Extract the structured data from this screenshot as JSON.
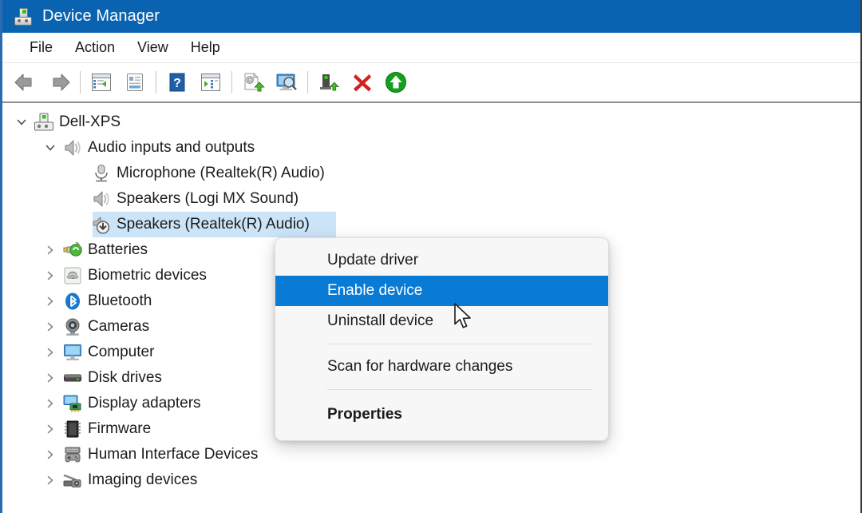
{
  "window": {
    "title": "Device Manager",
    "icon": "device-manager-icon"
  },
  "menubar": {
    "items": [
      {
        "label": "File"
      },
      {
        "label": "Action"
      },
      {
        "label": "View"
      },
      {
        "label": "Help"
      }
    ]
  },
  "toolbar": {
    "buttons": [
      {
        "name": "back-icon",
        "tooltip": "Back"
      },
      {
        "name": "forward-icon",
        "tooltip": "Forward"
      },
      {
        "name": "show-hide-console-tree-icon",
        "tooltip": "Show/Hide Console Tree"
      },
      {
        "name": "properties-icon",
        "tooltip": "Properties"
      },
      {
        "name": "help-icon",
        "tooltip": "Help"
      },
      {
        "name": "show-hide-action-pane-icon",
        "tooltip": "Show/Hide Action Pane"
      },
      {
        "name": "update-driver-icon",
        "tooltip": "Update driver"
      },
      {
        "name": "scan-for-hardware-changes-icon",
        "tooltip": "Scan for hardware changes"
      },
      {
        "name": "uninstall-device-icon",
        "tooltip": "Uninstall device"
      },
      {
        "name": "disable-device-icon",
        "tooltip": "Disable device"
      },
      {
        "name": "enable-device-icon",
        "tooltip": "Enable device"
      }
    ]
  },
  "tree": {
    "nodes": [
      {
        "label": "Dell-XPS",
        "level": 1,
        "expander": "expanded",
        "icon": "computer-device-icon",
        "selected": false
      },
      {
        "label": "Audio inputs and outputs",
        "level": 2,
        "expander": "expanded",
        "icon": "speaker-icon",
        "selected": false
      },
      {
        "label": "Microphone (Realtek(R) Audio)",
        "level": 3,
        "expander": "none",
        "icon": "microphone-icon",
        "selected": false
      },
      {
        "label": "Speakers (Logi MX Sound)",
        "level": 3,
        "expander": "none",
        "icon": "speaker-icon",
        "selected": false
      },
      {
        "label": "Speakers (Realtek(R) Audio)",
        "level": 3,
        "expander": "none",
        "icon": "speaker-disabled-icon",
        "selected": true
      },
      {
        "label": "Batteries",
        "level": 2,
        "expander": "collapsed",
        "icon": "battery-icon",
        "selected": false
      },
      {
        "label": "Biometric devices",
        "level": 2,
        "expander": "collapsed",
        "icon": "fingerprint-icon",
        "selected": false
      },
      {
        "label": "Bluetooth",
        "level": 2,
        "expander": "collapsed",
        "icon": "bluetooth-icon",
        "selected": false
      },
      {
        "label": "Cameras",
        "level": 2,
        "expander": "collapsed",
        "icon": "camera-icon",
        "selected": false
      },
      {
        "label": "Computer",
        "level": 2,
        "expander": "collapsed",
        "icon": "monitor-icon",
        "selected": false
      },
      {
        "label": "Disk drives",
        "level": 2,
        "expander": "collapsed",
        "icon": "disk-drive-icon",
        "selected": false
      },
      {
        "label": "Display adapters",
        "level": 2,
        "expander": "collapsed",
        "icon": "display-adapter-icon",
        "selected": false
      },
      {
        "label": "Firmware",
        "level": 2,
        "expander": "collapsed",
        "icon": "firmware-chip-icon",
        "selected": false
      },
      {
        "label": "Human Interface Devices",
        "level": 2,
        "expander": "collapsed",
        "icon": "hid-gamepad-icon",
        "selected": false
      },
      {
        "label": "Imaging devices",
        "level": 2,
        "expander": "collapsed",
        "icon": "imaging-scanner-icon",
        "selected": false
      }
    ]
  },
  "context_menu": {
    "items": [
      {
        "label": "Update driver",
        "highlighted": false,
        "bold": false
      },
      {
        "label": "Enable device",
        "highlighted": true,
        "bold": false
      },
      {
        "label": "Uninstall device",
        "highlighted": false,
        "bold": false
      },
      {
        "separator": true
      },
      {
        "label": "Scan for hardware changes",
        "highlighted": false,
        "bold": false
      },
      {
        "separator": true
      },
      {
        "label": "Properties",
        "highlighted": false,
        "bold": true
      }
    ]
  },
  "colors": {
    "titlebar": "#0A63B0",
    "menu_highlight": "#0A7BD4",
    "tree_selection": "#CCE4F7",
    "text": "#1b1b1b"
  },
  "cursor": {
    "type": "arrow-pointer"
  }
}
